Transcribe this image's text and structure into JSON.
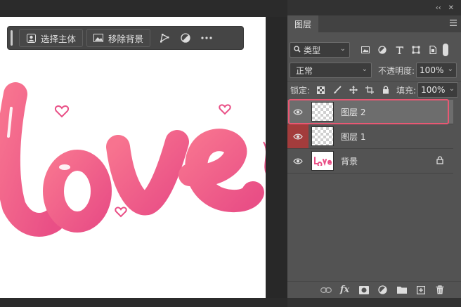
{
  "taskbar": {
    "select_subject_label": "选择主体",
    "remove_bg_label": "移除背景"
  },
  "panel": {
    "top_collapse": "‹‹",
    "top_close": "✕",
    "tab_label": "图层"
  },
  "filter": {
    "kind_label": "类型",
    "icons": [
      "image-filter-icon",
      "adjustment-filter-icon",
      "type-filter-icon",
      "shape-filter-icon",
      "smart-object-filter-icon"
    ]
  },
  "blend": {
    "mode": "正常",
    "opacity_label": "不透明度:",
    "opacity_value": "100%"
  },
  "lock": {
    "label": "锁定:",
    "fill_label": "填充:",
    "fill_value": "100%"
  },
  "layers": [
    {
      "name": "图层 2",
      "selected": true,
      "eye_highlight": false,
      "locked": false
    },
    {
      "name": "图层 1",
      "selected": false,
      "eye_highlight": true,
      "locked": false
    },
    {
      "name": "背景",
      "selected": false,
      "eye_highlight": false,
      "locked": true
    }
  ],
  "colors": {
    "accent": "#e85873",
    "love_start": "#f56b8e",
    "love_end": "#ea5488",
    "eye_highlight": "#a33c3c"
  },
  "bottom_icons": [
    "link-icon",
    "fx-icon",
    "mask-icon",
    "adjustment-icon",
    "folder-icon",
    "new-layer-icon",
    "trash-icon"
  ],
  "fx_label": "fx"
}
